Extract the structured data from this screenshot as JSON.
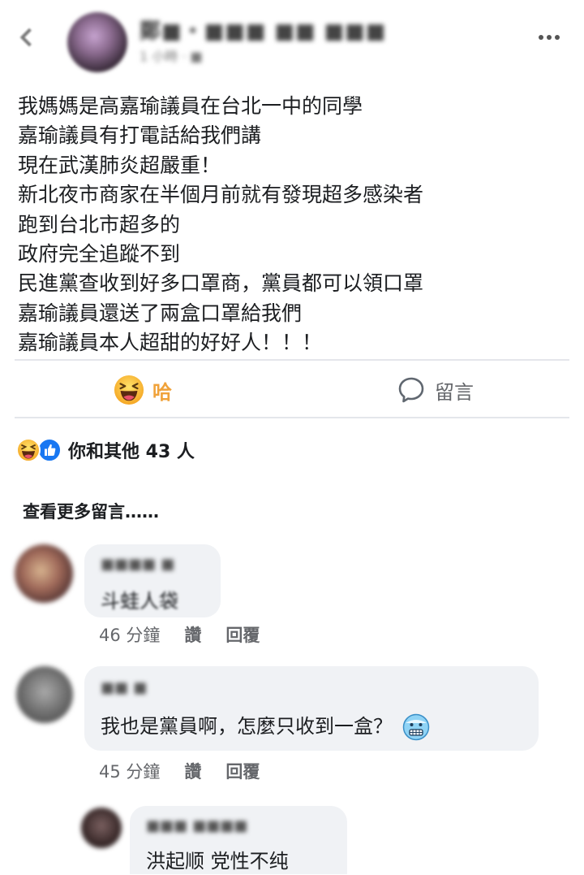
{
  "post": {
    "author": "鄭■・■■■ ■■ ■■■",
    "meta": "1 小時 · ■",
    "lines": [
      "我媽媽是高嘉瑜議員在台北一中的同學",
      "嘉瑜議員有打電話給我們講",
      "現在武漢肺炎超嚴重！",
      "新北夜市商家在半個月前就有發現超多感染者",
      "跑到台北市超多的",
      "政府完全追蹤不到",
      "民進黨查收到好多口罩商，黨員都可以領口罩",
      "嘉瑜議員還送了兩盒口罩給我們",
      "嘉瑜議員本人超甜的好好人！！！"
    ]
  },
  "actions": {
    "haha_label": "哈",
    "comment_label": "留言"
  },
  "reactions": {
    "summary": "你和其他 43 人",
    "icons": [
      "haha-icon",
      "like-icon"
    ]
  },
  "view_more": "查看更多留言……",
  "comments": [
    {
      "name": "■■■■ ■",
      "text": "斗蛙人袋",
      "time": "46 分鐘",
      "like": "讚",
      "reply": "回覆"
    },
    {
      "name": "■■ ■",
      "text": "我也是黨員啊，怎麼只收到一盒？",
      "emoji": "freezing-face-icon",
      "time": "45 分鐘",
      "like": "讚",
      "reply": "回覆"
    },
    {
      "name": "■■■ ■■■■",
      "text": "洪起顺 党性不纯"
    }
  ],
  "colors": {
    "haha_accent": "#f0a23a",
    "like_blue": "#1877f2",
    "bubble_bg": "#f0f2f5",
    "secondary_text": "#65676b"
  }
}
